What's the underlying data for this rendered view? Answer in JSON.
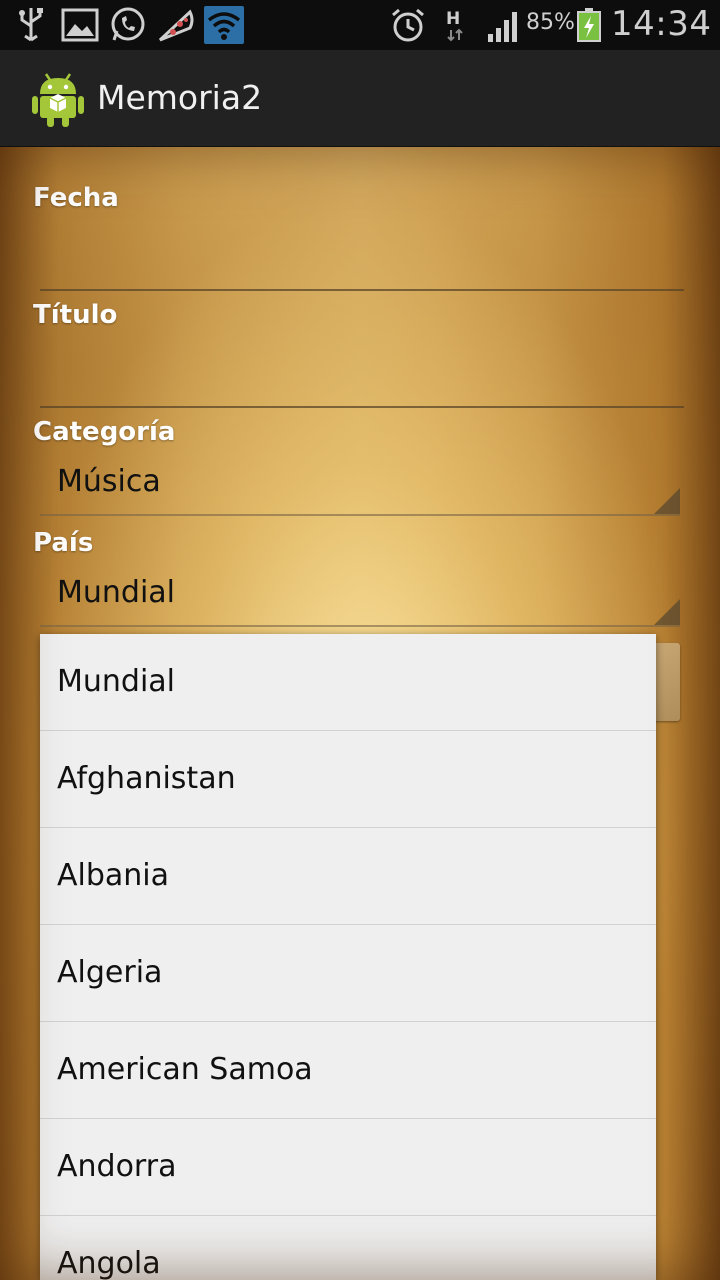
{
  "status_bar": {
    "battery_percent": "85%",
    "time": "14:34",
    "icons": [
      "usb-icon",
      "gallery-icon",
      "whatsapp-icon",
      "pizza-icon",
      "wifi-icon",
      "alarm-icon",
      "h-data-icon",
      "signal-icon",
      "battery-charging-icon"
    ]
  },
  "action_bar": {
    "title": "Memoria2",
    "logo": "android-logo"
  },
  "form": {
    "fecha_label": "Fecha",
    "fecha_value": "",
    "titulo_label": "Título",
    "titulo_value": "",
    "categoria_label": "Categoría",
    "categoria_value": "Música",
    "pais_label": "País",
    "pais_value": "Mundial"
  },
  "dropdown": {
    "items": [
      {
        "label": "Mundial"
      },
      {
        "label": "Afghanistan"
      },
      {
        "label": "Albania"
      },
      {
        "label": "Algeria"
      },
      {
        "label": "American Samoa"
      },
      {
        "label": "Andorra"
      },
      {
        "label": "Angola"
      }
    ]
  },
  "colors": {
    "status_bar_bg": "#0d0d0d",
    "action_bar_bg": "#222222",
    "dropdown_bg": "#efefef",
    "wifi_accent": "#2b6fa6",
    "battery_green": "#7ac142",
    "android_green": "#a4c639"
  }
}
